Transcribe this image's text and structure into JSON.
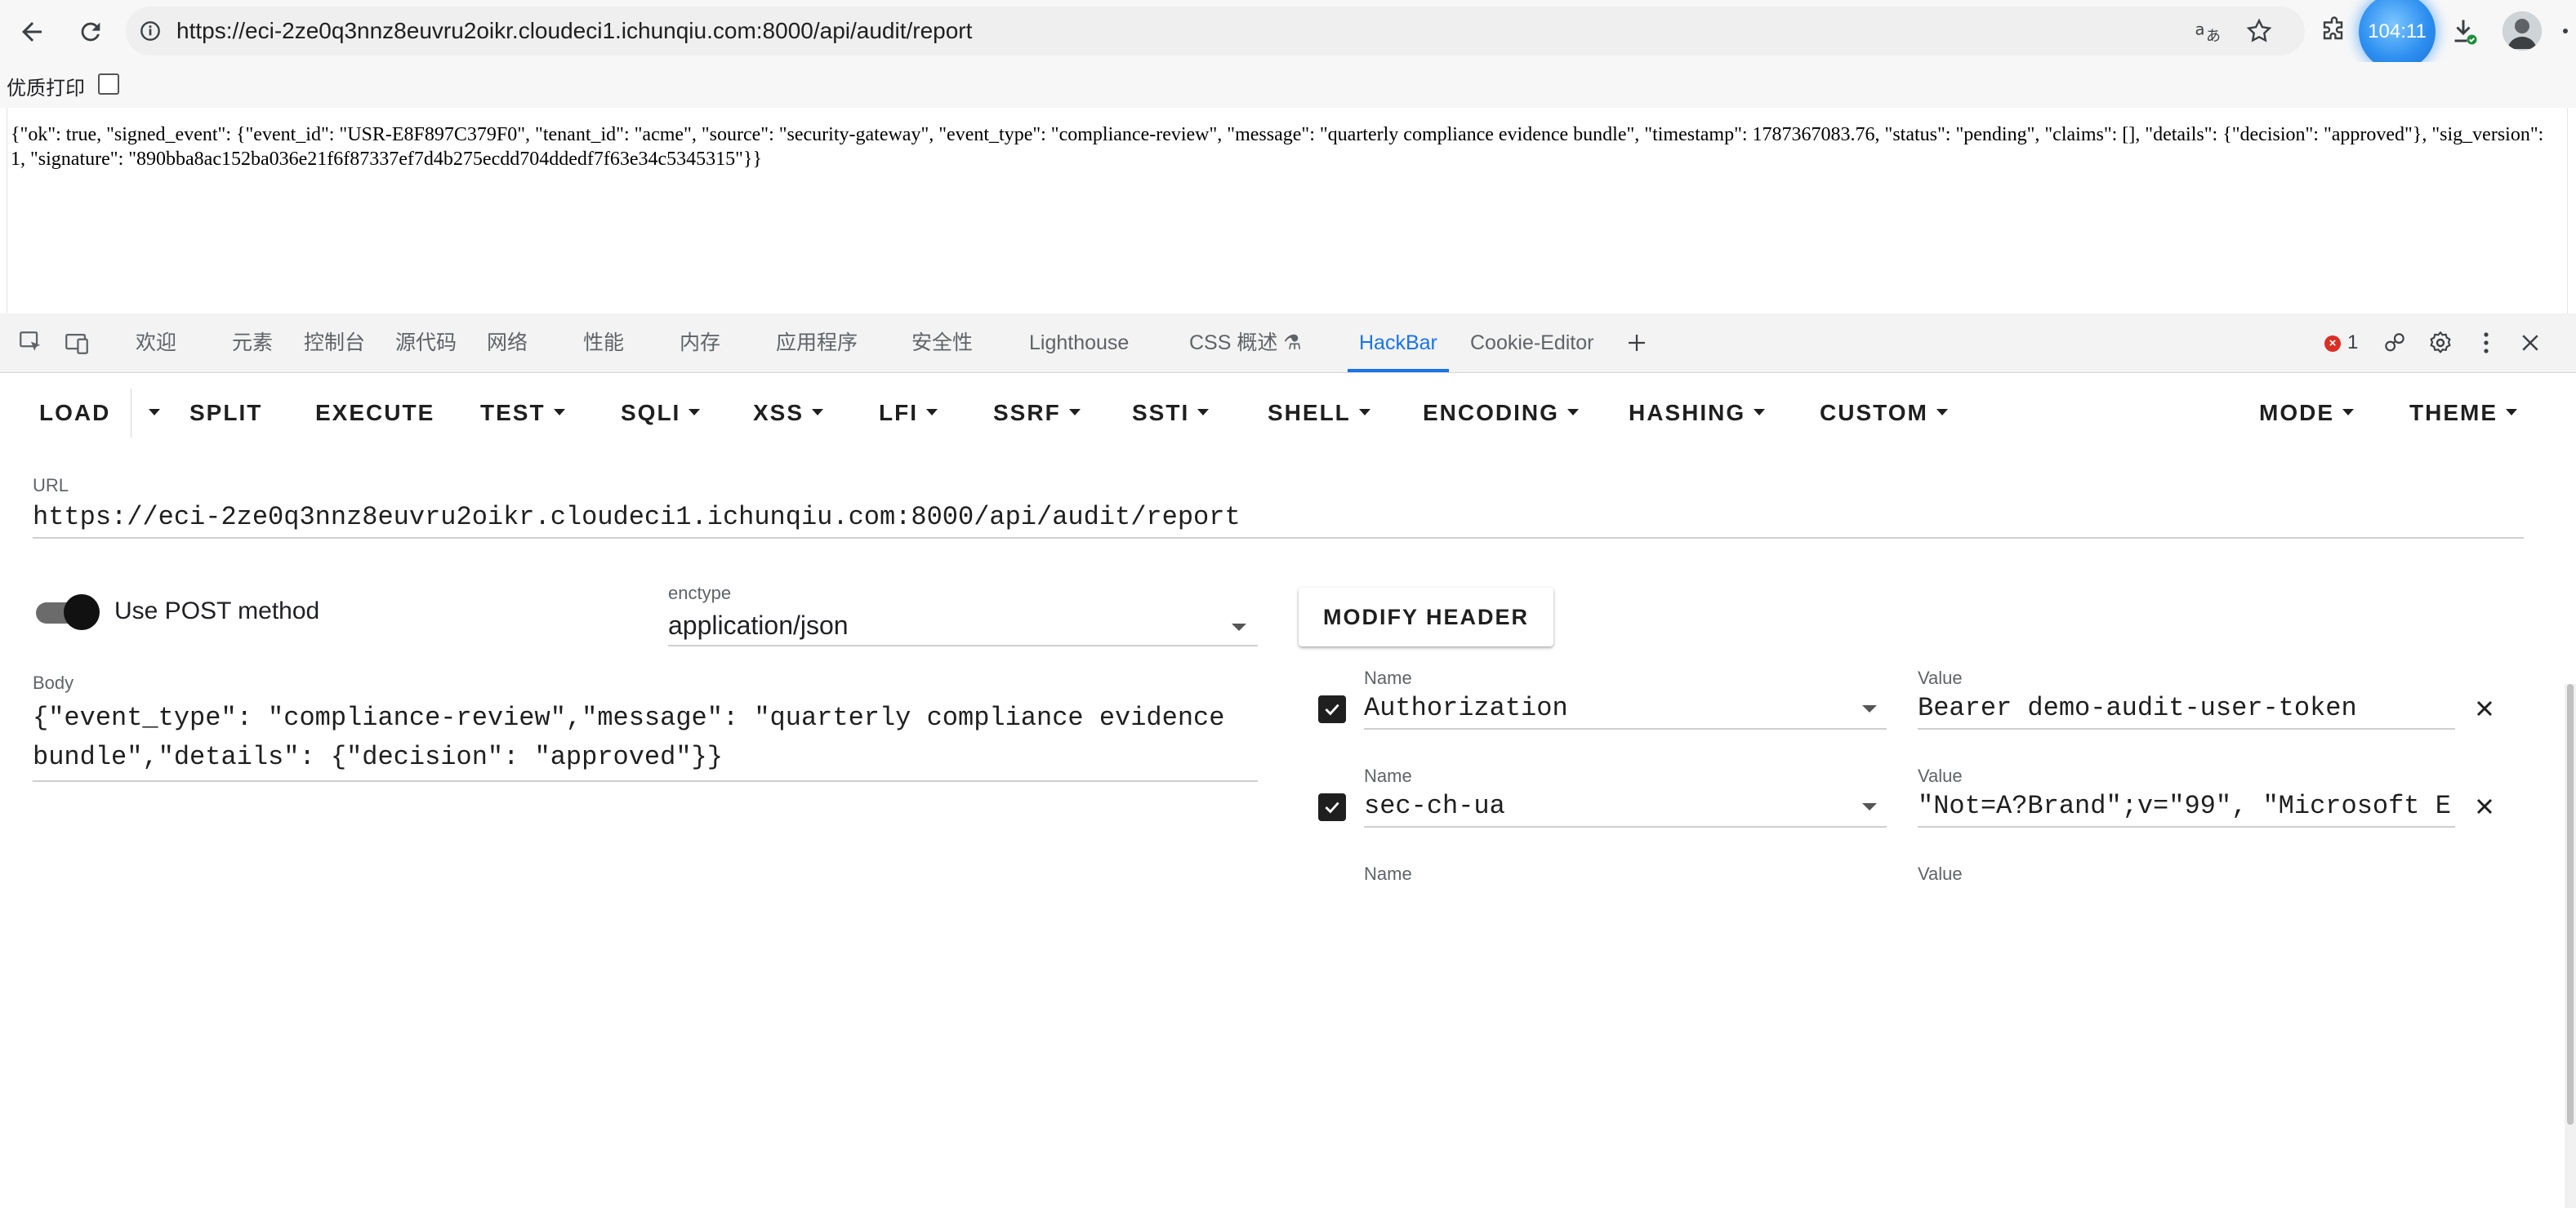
{
  "browser": {
    "url_prefix": "https://",
    "url_host": "eci-2ze0q3nnz8euvru2oikr.cloudeci1.ichunqiu.com",
    "url_rest": ":8000/api/audit/report",
    "badge_text": "104:11"
  },
  "print_bar": {
    "label": "优质打印"
  },
  "page": {
    "response": "{\"ok\": true, \"signed_event\": {\"event_id\": \"USR-E8F897C379F0\", \"tenant_id\": \"acme\", \"source\": \"security-gateway\", \"event_type\": \"compliance-review\", \"message\": \"quarterly compliance evidence bundle\", \"timestamp\": 1787367083.76, \"status\": \"pending\", \"claims\": [], \"details\": {\"decision\": \"approved\"}, \"sig_version\": 1, \"signature\": \"890bba8ac152ba036e21f6f87337ef7d4b275ecdd704ddedf7f63e34c5345315\"}}"
  },
  "devtools": {
    "tabs": [
      "欢迎",
      "元素",
      "控制台",
      "源代码",
      "网络",
      "性能",
      "内存",
      "应用程序",
      "安全性",
      "Lighthouse",
      "CSS 概述 ⚗",
      "HackBar",
      "Cookie-Editor"
    ],
    "active_tab": "HackBar",
    "error_count": "1"
  },
  "hackbar": {
    "menu": {
      "load": "LOAD",
      "split": "SPLIT",
      "execute": "EXECUTE",
      "test": "TEST",
      "sqli": "SQLI",
      "xss": "XSS",
      "lfi": "LFI",
      "ssrf": "SSRF",
      "ssti": "SSTI",
      "shell": "SHELL",
      "encoding": "ENCODING",
      "hashing": "HASHING",
      "custom": "CUSTOM",
      "mode": "MODE",
      "theme": "THEME"
    },
    "url_label": "URL",
    "url_value": "https://eci-2ze0q3nnz8euvru2oikr.cloudeci1.ichunqiu.com:8000/api/audit/report",
    "post_label": "Use POST method",
    "post_enabled": true,
    "enctype_label": "enctype",
    "enctype_value": "application/json",
    "modify_header": "MODIFY HEADER",
    "body_label": "Body",
    "body_value": "{\"event_type\": \"compliance-review\",\"message\": \"quarterly compliance evidence bundle\",\"details\": {\"decision\": \"approved\"}}",
    "headers": [
      {
        "name_label": "Name",
        "name": "Authorization",
        "value_label": "Value",
        "value": "Bearer demo-audit-user-token",
        "checked": true
      },
      {
        "name_label": "Name",
        "name": "sec-ch-ua",
        "value_label": "Value",
        "value": "\"Not=A?Brand\";v=\"99\", \"Microsoft E",
        "checked": true
      },
      {
        "name_label": "Name",
        "value_label": "Value"
      }
    ]
  }
}
